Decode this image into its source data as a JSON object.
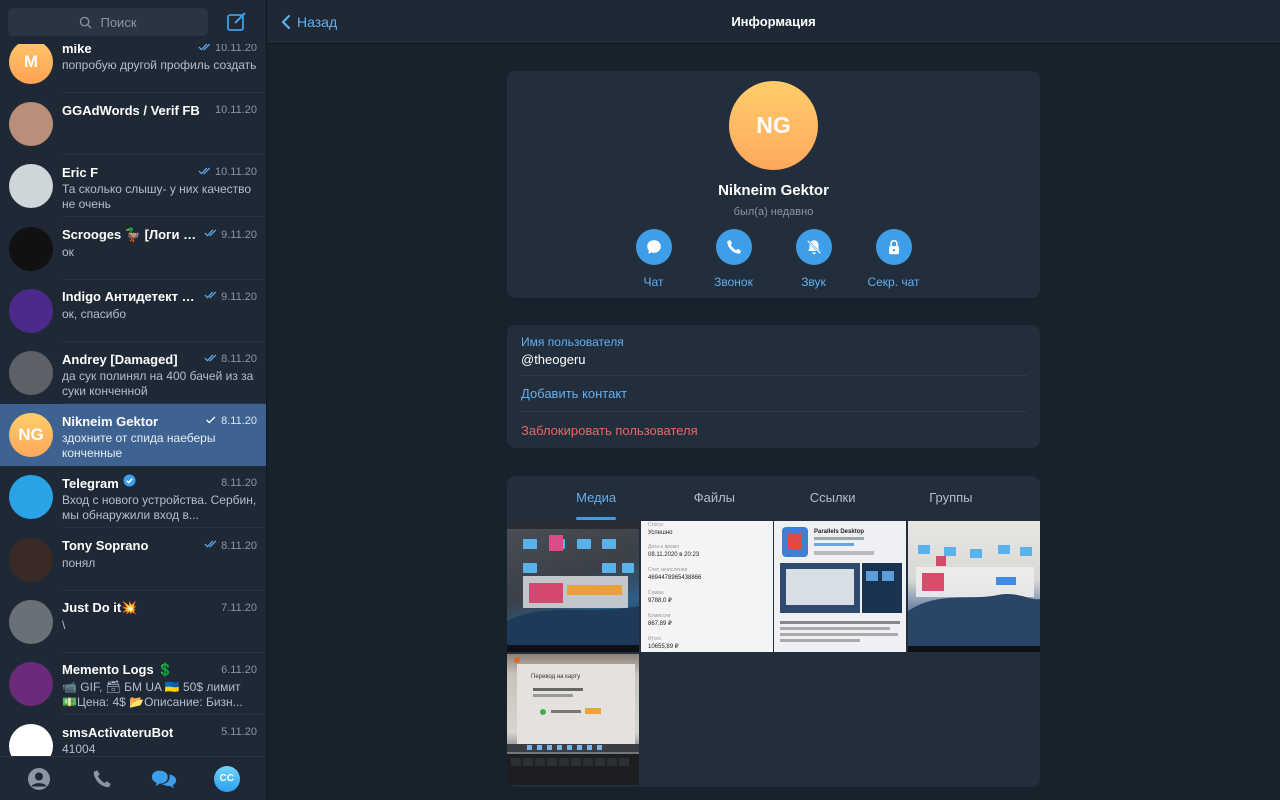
{
  "sidebar": {
    "search_placeholder": "Поиск",
    "chats": [
      {
        "name": "mike",
        "date": "10.11.20",
        "checks": "double",
        "message": "попробую другой профиль создать",
        "avatar_letter": "M",
        "avatar_color": "#ffb35a"
      },
      {
        "name": "GGAdWords / Verif FB",
        "date": "10.11.20",
        "checks": "none",
        "message": "",
        "avatar_letter": "",
        "avatar_color": "#b98f7a"
      },
      {
        "name": "Eric F",
        "date": "10.11.20",
        "checks": "double",
        "message": "Та сколько слышу- у них качество не очень",
        "avatar_letter": "",
        "avatar_color": "#cfd6d9"
      },
      {
        "name": "Scrooges 🦆 [Логи F...",
        "date": "9.11.20",
        "checks": "double",
        "message": "ок",
        "avatar_letter": "",
        "avatar_color": "#111111"
      },
      {
        "name": "Indigo Антидетект S...",
        "date": "9.11.20",
        "checks": "double",
        "message": "ок, спасибо",
        "avatar_letter": "",
        "avatar_color": "#4b2a8c"
      },
      {
        "name": "Andrey [Damaged]",
        "date": "8.11.20",
        "checks": "double",
        "message": "да сук полинял на 400 бачей из за суки конченной",
        "avatar_letter": "",
        "avatar_color": "#5d6066"
      },
      {
        "name": "Nikneim Gektor",
        "date": "8.11.20",
        "checks": "single",
        "message": "здохните от спида наеберы конченные",
        "avatar_letter": "NG",
        "avatar_color": "#ffba63",
        "active": true
      },
      {
        "name": "Telegram",
        "date": "8.11.20",
        "checks": "none",
        "verified": true,
        "message": "Вход с нового устройства. Сербин, мы обнаружили вход в...",
        "avatar_letter": "",
        "avatar_color": "#2aa3e6"
      },
      {
        "name": "Tony Soprano",
        "date": "8.11.20",
        "checks": "double",
        "message": "понял",
        "avatar_letter": "",
        "avatar_color": "#3a2a26"
      },
      {
        "name": "Just Do it💥",
        "date": "7.11.20",
        "checks": "none",
        "message": "\\",
        "avatar_letter": "",
        "avatar_color": "#6a7078"
      },
      {
        "name": "Memento Logs 💲",
        "date": "6.11.20",
        "checks": "none",
        "message": "📹 GIF, 🗃 БМ UA 🇺🇦 50$ лимит 💵Цена: 4$ 📂Описание: Бизн...",
        "avatar_letter": "",
        "avatar_color": "#6a2b7a"
      },
      {
        "name": "smsActivateruBot",
        "date": "5.11.20",
        "checks": "none",
        "message": "41004",
        "avatar_letter": "",
        "avatar_color": "#ffffff"
      }
    ],
    "bottom_avatar": "CC"
  },
  "topbar": {
    "back_label": "Назад",
    "title": "Информация"
  },
  "profile": {
    "initials": "NG",
    "name": "Nikneim Gektor",
    "status": "был(а) недавно",
    "actions": [
      {
        "label": "Чат",
        "icon": "chat-bubble-icon"
      },
      {
        "label": "Звонок",
        "icon": "phone-icon"
      },
      {
        "label": "Звук",
        "icon": "bell-muted-icon"
      },
      {
        "label": "Секр. чат",
        "icon": "lock-icon"
      }
    ]
  },
  "info": {
    "username_label": "Имя пользователя",
    "username": "@theogeru",
    "add_contact": "Добавить контакт",
    "block_user": "Заблокировать пользователя"
  },
  "media": {
    "tabs": [
      "Медиа",
      "Файлы",
      "Ссылки",
      "Группы"
    ],
    "active_tab": 0,
    "receipt_lines": [
      "Статус",
      "Успешно",
      "Дата и время",
      "08.11.2020 в 20:23",
      "Счет зачисления",
      "4694478965438866",
      "Сумма",
      "9788,0 ₽",
      "Комиссия",
      "867,89 ₽",
      "Итого",
      "10655,89 ₽"
    ],
    "app_title": "Parallels Desktop",
    "transfer_title": "Перевод на карту"
  },
  "colors": {
    "accent": "#3e9ee9",
    "link": "#62aff0",
    "danger": "#ec6565",
    "panel": "#232e3c",
    "bg": "#18222d"
  }
}
